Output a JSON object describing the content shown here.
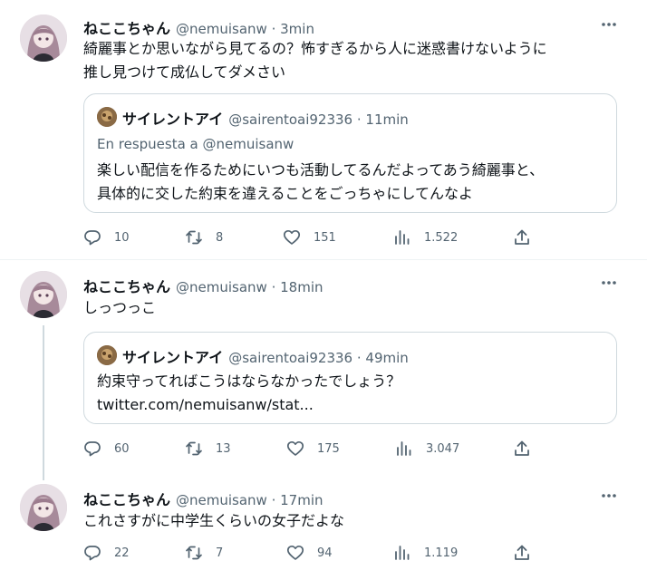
{
  "tweets": [
    {
      "name": "ねここちゃん",
      "handle": "@nemuisanw",
      "time": "3min",
      "text_lines": [
        "綺麗事とか思いながら見てるの？怖すぎるから人に迷惑書けないように",
        "推し見つけて成仏してダメさい"
      ],
      "quote": {
        "name": "サイレントアイ",
        "handle": "@sairentoai92336",
        "time": "11min",
        "reply_prefix": "En respuesta a ",
        "reply_handle": "@nemuisanw",
        "text_lines": [
          "楽しい配信を作るためにいつも活動してるんだよってあう綺麗事と、",
          "具体的に交した約束を違えることをごっちゃにしてんなよ"
        ]
      },
      "stats": {
        "replies": "10",
        "retweets": "8",
        "likes": "151",
        "views": "1.522"
      }
    },
    {
      "name": "ねここちゃん",
      "handle": "@nemuisanw",
      "time": "18min",
      "text_lines": [
        "しっつっこ"
      ],
      "quote": {
        "name": "サイレントアイ",
        "handle": "@sairentoai92336",
        "time": "49min",
        "text_lines": [
          "約束守ってればこうはならなかったでしょう？"
        ],
        "link": "twitter.com/nemuisanw/stat..."
      },
      "stats": {
        "replies": "60",
        "retweets": "13",
        "likes": "175",
        "views": "3.047"
      }
    },
    {
      "name": "ねここちゃん",
      "handle": "@nemuisanw",
      "time": "17min",
      "text_lines": [
        "これさすがに中学生くらいの女子だよな"
      ],
      "stats": {
        "replies": "22",
        "retweets": "7",
        "likes": "94",
        "views": "1.119"
      }
    }
  ],
  "separator": " · ",
  "icons": {
    "more": "more-icon",
    "reply": "reply-icon",
    "retweet": "retweet-icon",
    "like": "heart-icon",
    "views": "views-icon",
    "share": "share-icon"
  },
  "colors": {
    "text": "#0f1419",
    "secondary": "#536471",
    "border": "#cfd9de",
    "thread_line": "#cfd9de"
  }
}
